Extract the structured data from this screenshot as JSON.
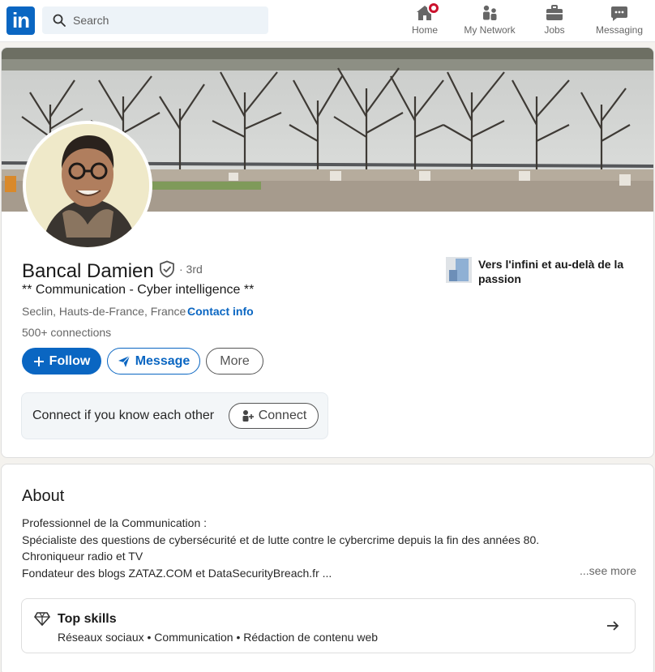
{
  "nav": {
    "logo_text": "in",
    "search_placeholder": "Search",
    "items": [
      {
        "label": "Home",
        "icon": "home-icon"
      },
      {
        "label": "My Network",
        "icon": "network-icon"
      },
      {
        "label": "Jobs",
        "icon": "briefcase-icon"
      },
      {
        "label": "Messaging",
        "icon": "messaging-icon"
      }
    ]
  },
  "profile": {
    "name": "Bancal Damien",
    "degree": "· 3rd",
    "headline": "** Communication - Cyber intelligence **",
    "location": "Seclin, Hauts-de-France, France ·",
    "contact_info": "Contact info",
    "connections": "500+ connections",
    "buttons": {
      "follow": "Follow",
      "message": "Message",
      "more": "More"
    },
    "connect_prompt": "Connect if you know each other",
    "connect_button": "Connect",
    "featured_text": "Vers l'infini et au-delà de la passion"
  },
  "about": {
    "title": "About",
    "lines": [
      "Professionnel de la Communication :",
      "Spécialiste des questions de cybersécurité et de lutte contre le cybercrime depuis la fin des années 80.",
      "Chroniqueur radio et TV",
      "Fondateur des blogs ZATAZ.COM et DataSecurityBreach.fr ..."
    ],
    "see_more": "...see more",
    "top_skills_title": "Top skills",
    "top_skills": "Réseaux sociaux • Communication • Rédaction de contenu web"
  },
  "colors": {
    "brand": "#0a66c2",
    "notification": "#cb112d",
    "page_bg": "#f4f2ee"
  }
}
